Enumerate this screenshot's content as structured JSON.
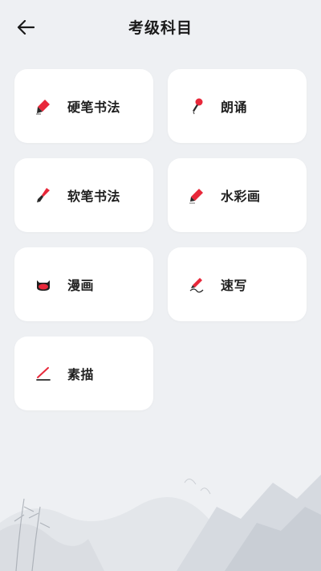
{
  "header": {
    "title": "考级科目",
    "back_icon": "arrow-left-icon"
  },
  "subjects": [
    {
      "label": "硬笔书法",
      "icon": "fountain-pen-icon"
    },
    {
      "label": "朗诵",
      "icon": "microphone-icon"
    },
    {
      "label": "软笔书法",
      "icon": "brush-icon"
    },
    {
      "label": "水彩画",
      "icon": "pencil-icon"
    },
    {
      "label": "漫画",
      "icon": "cartoon-cat-icon"
    },
    {
      "label": "速写",
      "icon": "sketch-pen-icon"
    },
    {
      "label": "素描",
      "icon": "drawing-line-icon"
    }
  ],
  "colors": {
    "accent": "#e8283a",
    "background": "#eef0f3",
    "card": "#ffffff",
    "text": "#1f1f1f"
  }
}
